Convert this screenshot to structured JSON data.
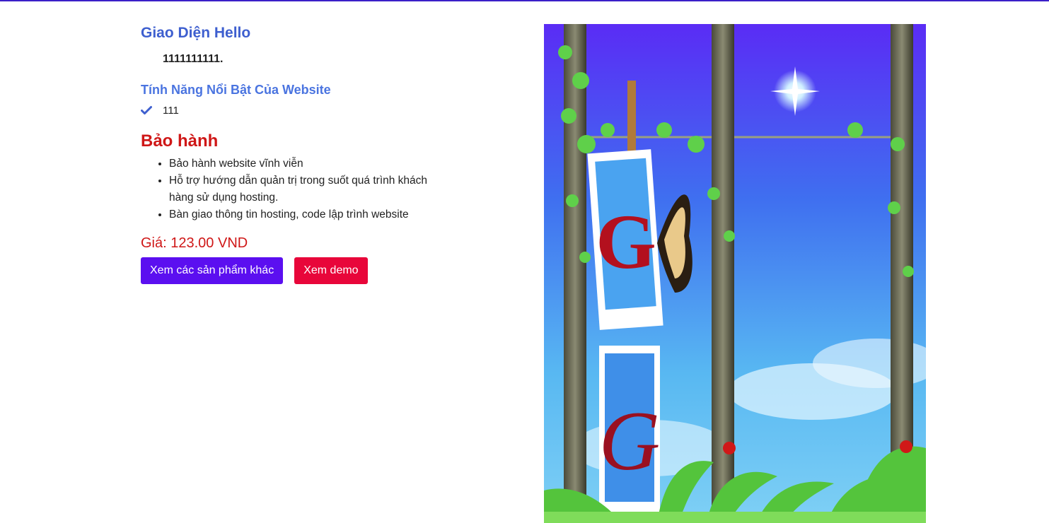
{
  "product": {
    "title": "Giao Diện Hello",
    "description": "1111111111."
  },
  "features": {
    "heading": "Tính Năng Nổi Bật Của Website",
    "items": [
      "111"
    ]
  },
  "warranty": {
    "heading": "Bảo hành",
    "items": [
      "Bảo hành website vĩnh viễn",
      "Hỗ trợ hướng dẫn quản trị trong suốt quá trình khách hàng sử dụng hosting.",
      "Bàn giao thông tin hosting, code lập trình website"
    ]
  },
  "price": {
    "label": "Giá: ",
    "value": "123.00 VND"
  },
  "buttons": {
    "other_products": "Xem các sản phẩm khác",
    "demo": "Xem demo"
  },
  "colors": {
    "accent": "#5b0ff0",
    "danger": "#e8063a",
    "title": "#3e5fcf",
    "price": "#cf1717"
  },
  "image": {
    "letters": [
      "G",
      "G"
    ]
  }
}
